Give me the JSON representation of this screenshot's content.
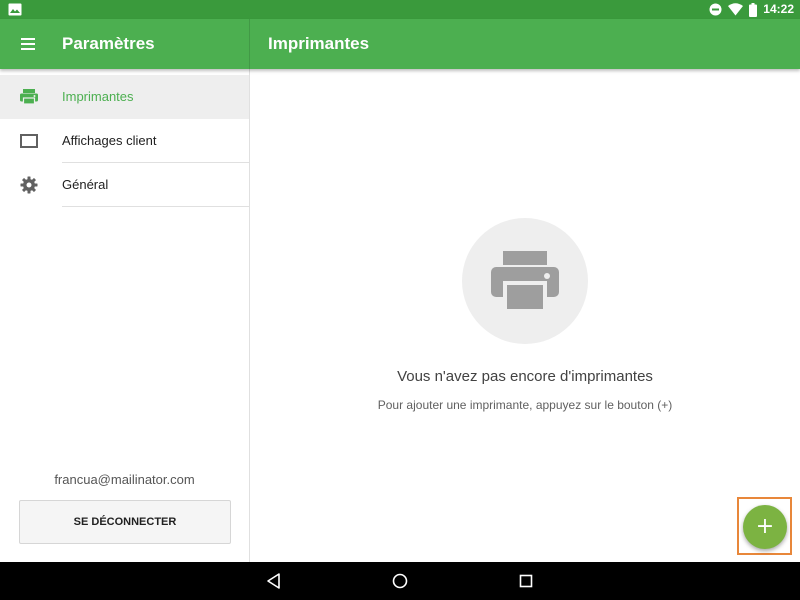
{
  "status_bar": {
    "time": "14:22",
    "icons": [
      "image-icon",
      "do-not-disturb-icon",
      "wifi-icon",
      "battery-icon"
    ]
  },
  "app_bar": {
    "left_title": "Paramètres",
    "right_title": "Imprimantes",
    "color": "#4caf50"
  },
  "sidebar": {
    "items": [
      {
        "label": "Imprimantes",
        "icon": "printer-icon",
        "active": true
      },
      {
        "label": "Affichages client",
        "icon": "display-icon",
        "active": false
      },
      {
        "label": "Général",
        "icon": "gear-icon",
        "active": false
      }
    ],
    "email": "francua@mailinator.com",
    "logout_label": "SE DÉCONNECTER"
  },
  "main": {
    "empty_icon": "printer-icon",
    "empty_title": "Vous n'avez pas encore d'imprimantes",
    "empty_subtitle": "Pour ajouter une imprimante, appuyez sur le bouton (+)"
  },
  "fab": {
    "label": "+",
    "color": "#7cb342",
    "highlight_color": "#e8873a"
  },
  "nav_bar": {
    "buttons": [
      "back-icon",
      "home-icon",
      "recents-icon"
    ]
  }
}
